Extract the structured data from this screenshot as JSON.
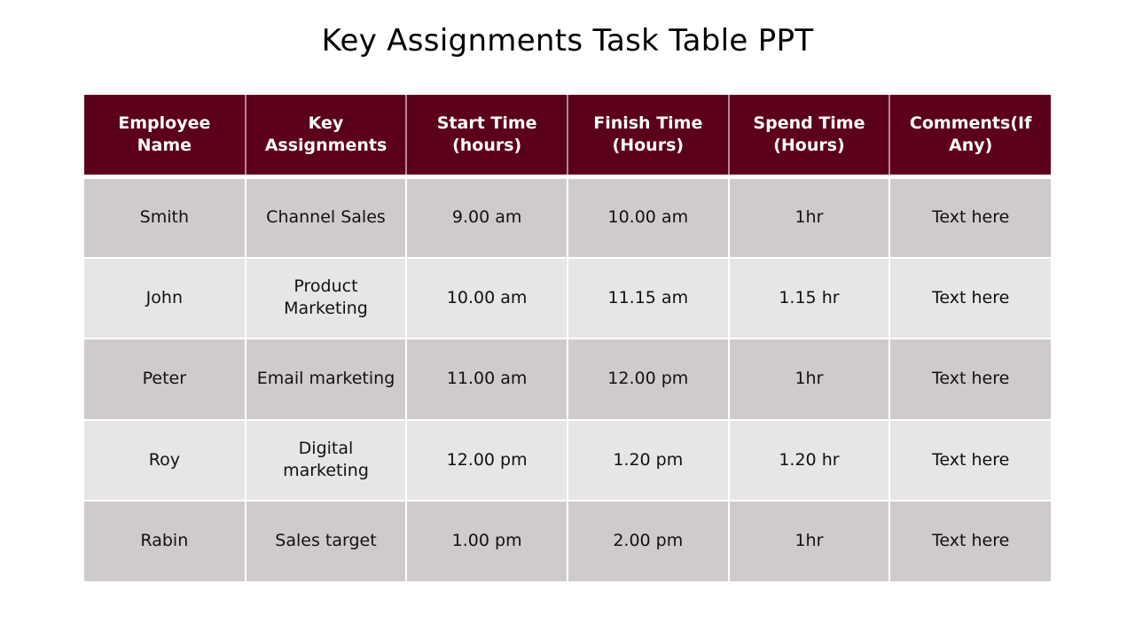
{
  "title": "Key Assignments Task Table PPT",
  "colors": {
    "header_bg": "#5c0019",
    "row_dark": "#d0cbcb",
    "row_light": "#e8e6e5"
  },
  "table": {
    "headers": [
      "Employee Name",
      "Key Assignments",
      "Start Time (hours)",
      "Finish Time (Hours)",
      "Spend Time (Hours)",
      "Comments(If Any)"
    ],
    "rows": [
      [
        "Smith",
        "Channel Sales",
        "9.00 am",
        "10.00 am",
        "1hr",
        "Text here"
      ],
      [
        "John",
        "Product Marketing",
        "10.00 am",
        "11.15 am",
        "1.15 hr",
        "Text here"
      ],
      [
        "Peter",
        "Email marketing",
        "11.00 am",
        "12.00 pm",
        "1hr",
        "Text here"
      ],
      [
        "Roy",
        "Digital marketing",
        "12.00 pm",
        "1.20 pm",
        "1.20 hr",
        "Text here"
      ],
      [
        "Rabin",
        "Sales target",
        "1.00 pm",
        "2.00 pm",
        "1hr",
        "Text here"
      ]
    ]
  }
}
